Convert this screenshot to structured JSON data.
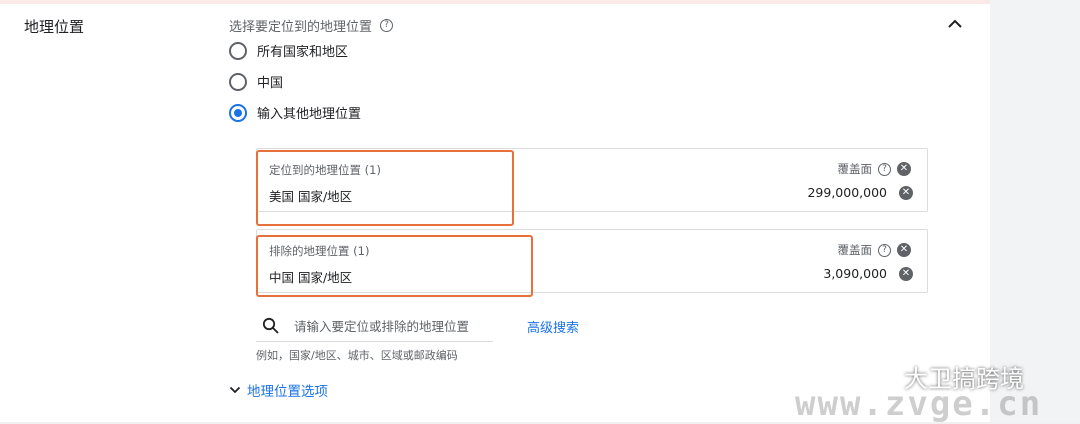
{
  "section": {
    "label": "地理位置",
    "prompt": "选择要定位到的地理位置",
    "help_glyph": "?"
  },
  "radio_options": [
    {
      "label": "所有国家和地区",
      "selected": false
    },
    {
      "label": "中国",
      "selected": false
    },
    {
      "label": "输入其他地理位置",
      "selected": true
    }
  ],
  "targeted": {
    "title": "定位到的地理位置 (1)",
    "coverage_label": "覆盖面",
    "item": "美国 国家/地区",
    "coverage_value": "299,000,000"
  },
  "excluded": {
    "title": "排除的地理位置 (1)",
    "coverage_label": "覆盖面",
    "item": "中国 国家/地区",
    "coverage_value": "3,090,000"
  },
  "search": {
    "placeholder": "请输入要定位或排除的地理位置",
    "advanced_label": "高级搜索",
    "example_text": "例如，国家/地区、城市、区域或邮政编码"
  },
  "options_link": {
    "label": "地理位置选项"
  },
  "watermark": {
    "name": "大卫搞跨境",
    "url": "www.zvge.cn"
  },
  "colors": {
    "accent": "#1a73e8",
    "highlight": "#e8703a",
    "text": "#202124",
    "secondary_text": "#5f6368"
  }
}
